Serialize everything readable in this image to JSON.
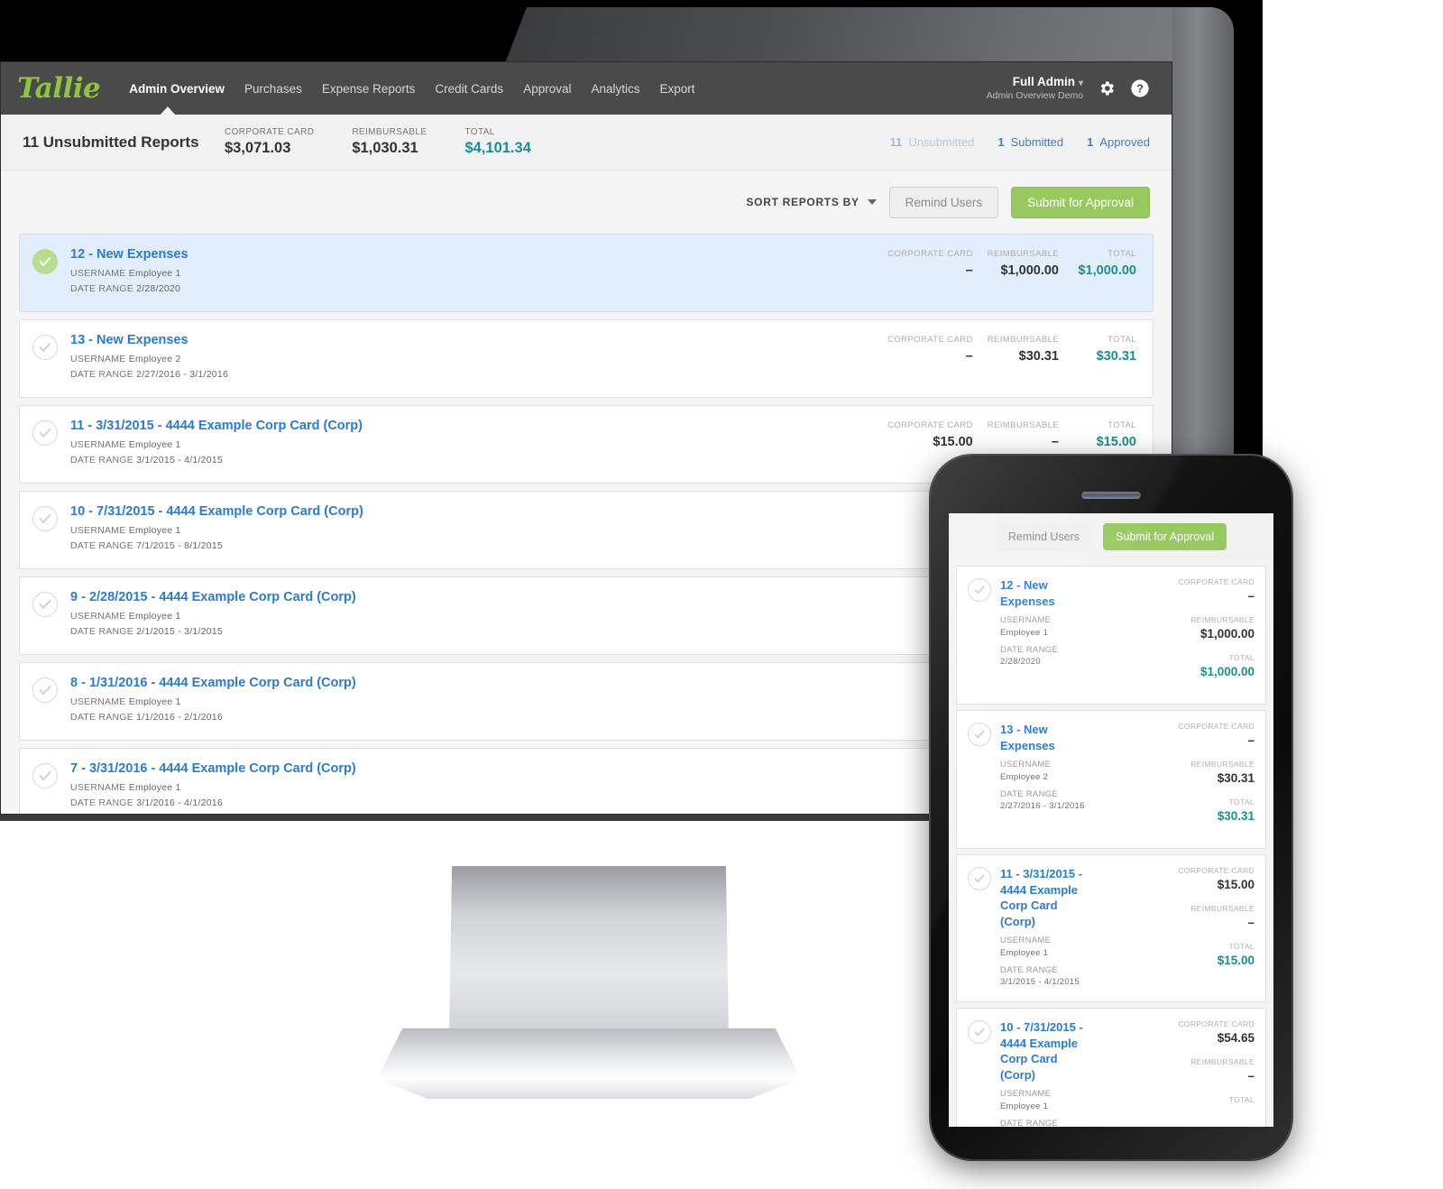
{
  "app": {
    "logo": "Tallie",
    "nav": [
      {
        "label": "Admin Overview",
        "active": true
      },
      {
        "label": "Purchases",
        "active": false
      },
      {
        "label": "Expense Reports",
        "active": false
      },
      {
        "label": "Credit Cards",
        "active": false
      },
      {
        "label": "Approval",
        "active": false
      },
      {
        "label": "Analytics",
        "active": false
      },
      {
        "label": "Export",
        "active": false
      }
    ],
    "user": {
      "name": "Full Admin",
      "caret": "▾",
      "subtitle": "Admin Overview Demo",
      "gear_icon": "gear-icon",
      "help_icon": "help-icon"
    }
  },
  "summary": {
    "title": "11 Unsubmitted Reports",
    "stats": [
      {
        "label": "CORPORATE CARD",
        "value": "$3,071.03",
        "accent": false
      },
      {
        "label": "REIMBURSABLE",
        "value": "$1,030.31",
        "accent": false
      },
      {
        "label": "TOTAL",
        "value": "$4,101.34",
        "accent": true
      }
    ],
    "filters": [
      {
        "count": "11",
        "label": "Unsubmitted",
        "active": false
      },
      {
        "count": "1",
        "label": "Submitted",
        "active": true
      },
      {
        "count": "1",
        "label": "Approved",
        "active": true
      }
    ]
  },
  "toolbar": {
    "sort_label": "SORT REPORTS BY",
    "remind_label": "Remind Users",
    "submit_label": "Submit for Approval"
  },
  "column_labels": {
    "corporate_card": "CORPORATE CARD",
    "reimbursable": "REIMBURSABLE",
    "total": "TOTAL"
  },
  "meta_labels": {
    "username": "USERNAME",
    "date_range": "DATE RANGE"
  },
  "reports": [
    {
      "title": "12 - New Expenses",
      "username": "Employee 1",
      "date_range": "2/28/2020",
      "corporate_card": "–",
      "reimbursable": "$1,000.00",
      "total": "$1,000.00",
      "selected": true,
      "show_amounts": true
    },
    {
      "title": "13 - New Expenses",
      "username": "Employee 2",
      "date_range": "2/27/2016 - 3/1/2016",
      "corporate_card": "–",
      "reimbursable": "$30.31",
      "total": "$30.31",
      "selected": false,
      "show_amounts": true
    },
    {
      "title": "11 - 3/31/2015 - 4444 Example Corp Card (Corp)",
      "username": "Employee 1",
      "date_range": "3/1/2015 - 4/1/2015",
      "corporate_card": "$15.00",
      "reimbursable": "–",
      "total": "$15.00",
      "selected": false,
      "show_amounts": true
    },
    {
      "title": "10 - 7/31/2015 - 4444 Example Corp Card (Corp)",
      "username": "Employee 1",
      "date_range": "7/1/2015 - 8/1/2015",
      "corporate_card": "",
      "reimbursable": "",
      "total": "",
      "selected": false,
      "show_amounts": false
    },
    {
      "title": "9 - 2/28/2015 - 4444 Example Corp Card (Corp)",
      "username": "Employee 1",
      "date_range": "2/1/2015 - 3/1/2015",
      "corporate_card": "",
      "reimbursable": "",
      "total": "",
      "selected": false,
      "show_amounts": false
    },
    {
      "title": "8 - 1/31/2016 - 4444 Example Corp Card (Corp)",
      "username": "Employee 1",
      "date_range": "1/1/2016 - 2/1/2016",
      "corporate_card": "",
      "reimbursable": "",
      "total": "",
      "selected": false,
      "show_amounts": false
    },
    {
      "title": "7 - 3/31/2016 - 4444 Example Corp Card (Corp)",
      "username": "Employee 1",
      "date_range": "3/1/2016 - 4/1/2016",
      "corporate_card": "",
      "reimbursable": "",
      "total": "",
      "selected": false,
      "show_amounts": false
    }
  ],
  "phone": {
    "toolbar": {
      "remind_label": "Remind Users",
      "submit_label": "Submit for Approval"
    },
    "cards": [
      {
        "title": "12 - New Expenses",
        "username": "Employee 1",
        "date_range": "2/28/2020",
        "corporate_card": "–",
        "reimbursable": "$1,000.00",
        "total": "$1,000.00"
      },
      {
        "title": "13 - New Expenses",
        "username": "Employee 2",
        "date_range": "2/27/2016 - 3/1/2016",
        "corporate_card": "–",
        "reimbursable": "$30.31",
        "total": "$30.31"
      },
      {
        "title": "11 - 3/31/2015 - 4444 Example Corp Card (Corp)",
        "username": "Employee 1",
        "date_range": "3/1/2015 - 4/1/2015",
        "corporate_card": "$15.00",
        "reimbursable": "–",
        "total": "$15.00"
      },
      {
        "title": "10 - 7/31/2015 - 4444 Example Corp Card (Corp)",
        "username": "Employee 1",
        "date_range": "",
        "corporate_card": "$54.65",
        "reimbursable": "–",
        "total": ""
      }
    ]
  },
  "colors": {
    "brand_green": "#8cc63e",
    "link_blue": "#2b7bd4",
    "teal": "#1a8f93",
    "nav_bg": "#4a4a4a",
    "button_green": "#97c95f"
  }
}
